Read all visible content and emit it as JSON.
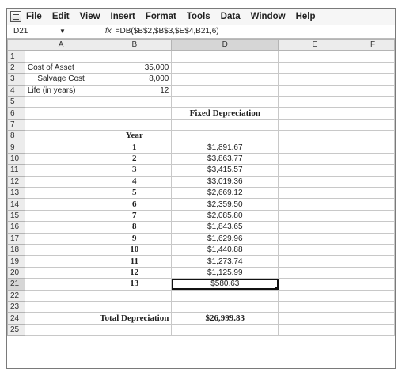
{
  "menu": {
    "items": [
      "File",
      "Edit",
      "View",
      "Insert",
      "Format",
      "Tools",
      "Data",
      "Window",
      "Help"
    ]
  },
  "formula_bar": {
    "name_box": "D21",
    "fx_label": "fx",
    "formula": "=DB($B$2,$B$3,$E$4,B21,6)"
  },
  "columns": [
    "A",
    "B",
    "D",
    "E",
    "F"
  ],
  "rows": [
    {
      "n": "1",
      "a": "",
      "b": "",
      "d": "",
      "e": ""
    },
    {
      "n": "2",
      "a": "Cost of Asset",
      "b": "35,000",
      "d": "",
      "e": ""
    },
    {
      "n": "3",
      "a": "Salvage Cost",
      "b": "8,000",
      "d": "",
      "e": ""
    },
    {
      "n": "4",
      "a": "Life (in years)",
      "b": "12",
      "d": "",
      "e": ""
    },
    {
      "n": "5",
      "a": "",
      "b": "",
      "d": "",
      "e": ""
    },
    {
      "n": "6",
      "a": "",
      "b": "",
      "d": "Fixed Depreciation",
      "e": ""
    },
    {
      "n": "7",
      "a": "",
      "b": "",
      "d": "",
      "e": ""
    },
    {
      "n": "8",
      "a": "",
      "b": "Year",
      "d": "",
      "e": ""
    },
    {
      "n": "9",
      "a": "",
      "b": "1",
      "d": "$1,891.67",
      "e": ""
    },
    {
      "n": "10",
      "a": "",
      "b": "2",
      "d": "$3,863.77",
      "e": ""
    },
    {
      "n": "11",
      "a": "",
      "b": "3",
      "d": "$3,415.57",
      "e": ""
    },
    {
      "n": "12",
      "a": "",
      "b": "4",
      "d": "$3,019.36",
      "e": ""
    },
    {
      "n": "13",
      "a": "",
      "b": "5",
      "d": "$2,669.12",
      "e": ""
    },
    {
      "n": "14",
      "a": "",
      "b": "6",
      "d": "$2,359.50",
      "e": ""
    },
    {
      "n": "15",
      "a": "",
      "b": "7",
      "d": "$2,085.80",
      "e": ""
    },
    {
      "n": "16",
      "a": "",
      "b": "8",
      "d": "$1,843.65",
      "e": ""
    },
    {
      "n": "17",
      "a": "",
      "b": "9",
      "d": "$1,629.96",
      "e": ""
    },
    {
      "n": "18",
      "a": "",
      "b": "10",
      "d": "$1,440.88",
      "e": ""
    },
    {
      "n": "19",
      "a": "",
      "b": "11",
      "d": "$1,273.74",
      "e": ""
    },
    {
      "n": "20",
      "a": "",
      "b": "12",
      "d": "$1,125.99",
      "e": ""
    },
    {
      "n": "21",
      "a": "",
      "b": "13",
      "d": "$580.63",
      "e": ""
    },
    {
      "n": "22",
      "a": "",
      "b": "",
      "d": "",
      "e": ""
    },
    {
      "n": "23",
      "a": "",
      "b": "",
      "d": "",
      "e": ""
    },
    {
      "n": "24",
      "a": "",
      "b": "Total Depreciation",
      "d": "$26,999.83",
      "e": ""
    },
    {
      "n": "25",
      "a": "",
      "b": "",
      "d": "",
      "e": ""
    }
  ]
}
